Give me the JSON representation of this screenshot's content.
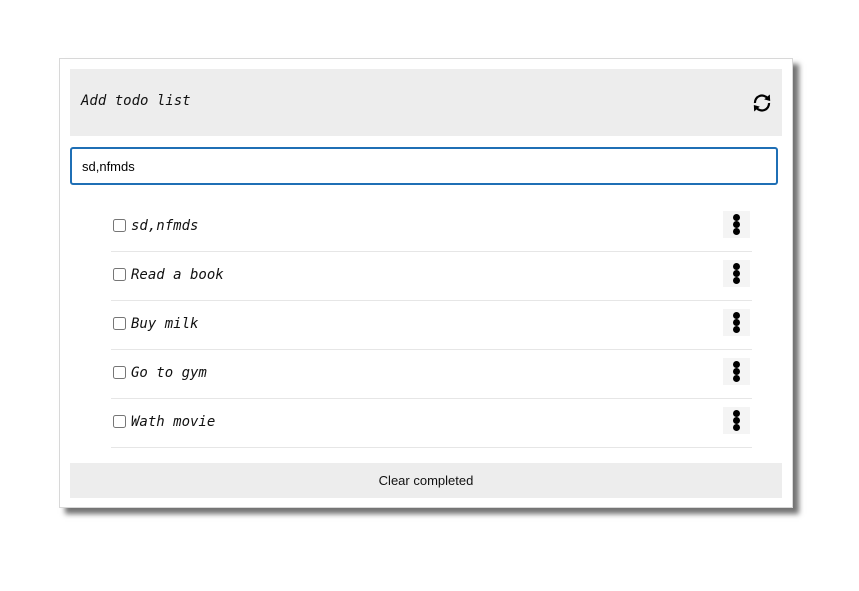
{
  "header": {
    "title": "Add todo list",
    "refresh_icon": "refresh-icon"
  },
  "input": {
    "value": "sd,nfmds"
  },
  "todos": [
    {
      "label": "sd,nfmds",
      "checked": false
    },
    {
      "label": "Read a book",
      "checked": false
    },
    {
      "label": "Buy milk",
      "checked": false
    },
    {
      "label": "Go to gym",
      "checked": false
    },
    {
      "label": "Wath movie",
      "checked": false
    }
  ],
  "item_menu_icon": "vertical-ellipsis-icon",
  "footer": {
    "clear_label": "Clear completed"
  },
  "colors": {
    "header_bg": "#ededed",
    "input_border": "#1f6fb5",
    "divider": "#e6e6e6"
  }
}
